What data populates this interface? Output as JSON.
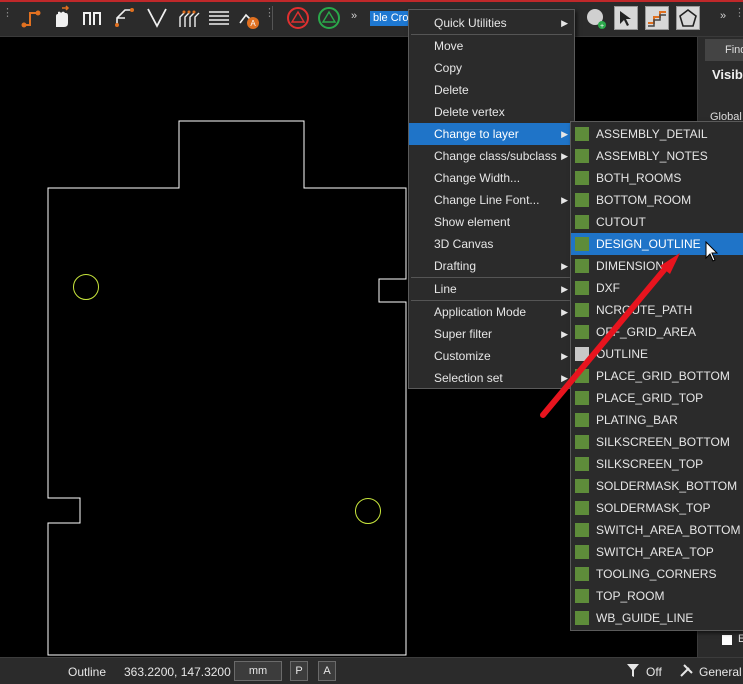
{
  "toolbar": {
    "subclass_chip": "ble Cross",
    "more_glyph": "»",
    "icons": [
      "add-connect-icon",
      "slide-icon",
      "bus-route-icon",
      "fanout-icon",
      "add-v-line-icon",
      "fanout-group-icon",
      "hatch-icon",
      "auto-route-icon",
      "show-rats-icon",
      "hide-rats-icon",
      "place-icon",
      "select-icon",
      "bump-icon",
      "polygon-icon"
    ]
  },
  "context_menu": {
    "items": [
      {
        "label": "Quick Utilities",
        "submenu": true
      },
      {
        "label": "Move",
        "submenu": false
      },
      {
        "label": "Copy",
        "submenu": false
      },
      {
        "label": "Delete",
        "submenu": false
      },
      {
        "label": "Delete vertex",
        "submenu": false
      },
      {
        "label": "Change to layer",
        "submenu": true,
        "highlighted": true
      },
      {
        "label": "Change class/subclass",
        "submenu": true
      },
      {
        "label": "Change Width...",
        "submenu": false
      },
      {
        "label": "Change Line Font...",
        "submenu": true
      },
      {
        "label": "Show element",
        "submenu": false
      },
      {
        "label": "3D Canvas",
        "submenu": false
      },
      {
        "label": "Drafting",
        "submenu": true
      },
      {
        "label": "Line",
        "submenu": true
      },
      {
        "label": "Application Mode",
        "submenu": true
      },
      {
        "label": "Super filter",
        "submenu": true
      },
      {
        "label": "Customize",
        "submenu": true
      },
      {
        "label": "Selection set",
        "submenu": true
      }
    ]
  },
  "layer_menu": {
    "items": [
      {
        "label": "ASSEMBLY_DETAIL",
        "color": "#5e8c3a"
      },
      {
        "label": "ASSEMBLY_NOTES",
        "color": "#5e8c3a"
      },
      {
        "label": "BOTH_ROOMS",
        "color": "#5e8c3a"
      },
      {
        "label": "BOTTOM_ROOM",
        "color": "#5e8c3a"
      },
      {
        "label": "CUTOUT",
        "color": "#5e8c3a"
      },
      {
        "label": "DESIGN_OUTLINE",
        "color": "#5e8c3a",
        "highlighted": true
      },
      {
        "label": "DIMENSION",
        "color": "#5e8c3a"
      },
      {
        "label": "DXF",
        "color": "#5e8c3a"
      },
      {
        "label": "NCROUTE_PATH",
        "color": "#5e8c3a"
      },
      {
        "label": "OFF_GRID_AREA",
        "color": "#5e8c3a"
      },
      {
        "label": "OUTLINE",
        "color": "#c8c8c8"
      },
      {
        "label": "PLACE_GRID_BOTTOM",
        "color": "#5e8c3a"
      },
      {
        "label": "PLACE_GRID_TOP",
        "color": "#5e8c3a"
      },
      {
        "label": "PLATING_BAR",
        "color": "#5e8c3a"
      },
      {
        "label": "SILKSCREEN_BOTTOM",
        "color": "#5e8c3a"
      },
      {
        "label": "SILKSCREEN_TOP",
        "color": "#5e8c3a"
      },
      {
        "label": "SOLDERMASK_BOTTOM",
        "color": "#5e8c3a"
      },
      {
        "label": "SOLDERMASK_TOP",
        "color": "#5e8c3a"
      },
      {
        "label": "SWITCH_AREA_BOTTOM",
        "color": "#5e8c3a"
      },
      {
        "label": "SWITCH_AREA_TOP",
        "color": "#5e8c3a"
      },
      {
        "label": "TOOLING_CORNERS",
        "color": "#5e8c3a"
      },
      {
        "label": "TOP_ROOM",
        "color": "#5e8c3a"
      },
      {
        "label": "WB_GUIDE_LINE",
        "color": "#5e8c3a"
      }
    ]
  },
  "right_panel": {
    "find_tab": "Find",
    "title": "Visib",
    "global_label": "Global",
    "checkbox_label": "E"
  },
  "status_bar": {
    "subclass": "Outline",
    "coords": "363.2200, 147.3200",
    "units": "mm",
    "p_button": "P",
    "a_button": "A",
    "filter_label": "Off",
    "mode_label": "General"
  },
  "colors": {
    "highlight": "#1f74c8",
    "outline_stroke": "#ffffff",
    "circle_stroke": "#c8e63c",
    "arrow": "#e8141e"
  }
}
